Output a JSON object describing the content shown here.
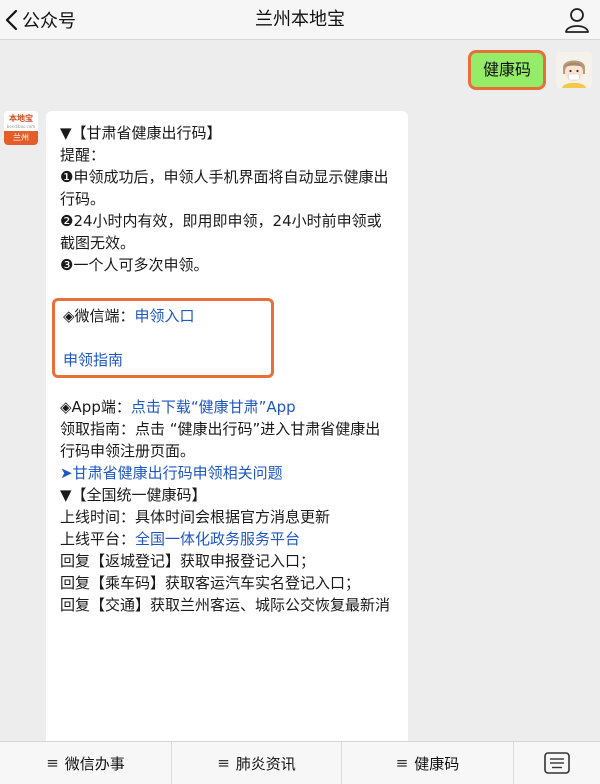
{
  "header": {
    "back_label": "公众号",
    "title": "兰州本地宝"
  },
  "outgoing": {
    "text": "健康码"
  },
  "bot": {
    "brand": "本地宝",
    "brand_sub": "bendibao.com",
    "city": "兰州"
  },
  "message": {
    "heading1": "▼【甘肃省健康出行码】",
    "reminder_title": "提醒：",
    "reminder_1": "❶申领成功后，申领人手机界面将自动显示健康出行码。",
    "reminder_2": "❷24小时内有效，即用即申领，24小时前申领或截图无效。",
    "reminder_3": "❸一个人可多次申领。",
    "wechat_label": "◈微信端：",
    "wechat_link": "申领入口",
    "guide_link": "申领指南",
    "app_label": "◈App端：",
    "app_link": "点击下载“健康甘肃”App",
    "pickup_guide": "领取指南：点击 “健康出行码”进入甘肃省健康出行码申领注册页面。",
    "faq_link": "➤甘肃省健康出行码申领相关问题",
    "heading2": "▼【全国统一健康码】",
    "online_time": "上线时间：具体时间会根据官方消息更新",
    "platform_label": "上线平台：",
    "platform_link": "全国一体化政务服务平台",
    "reply_1": "回复【返城登记】获取申报登记入口；",
    "reply_2": "回复【乘车码】获取客运汽车实名登记入口；",
    "reply_3": "回复【交通】获取兰州客运、城际公交恢复最新消"
  },
  "menu": {
    "items": [
      {
        "label": "微信办事"
      },
      {
        "label": "肺炎资讯"
      },
      {
        "label": "健康码"
      }
    ]
  }
}
